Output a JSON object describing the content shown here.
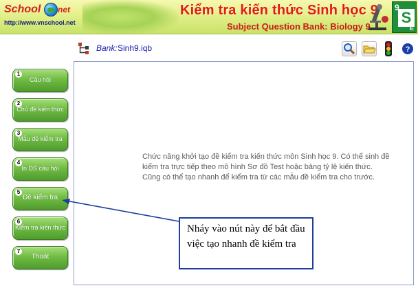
{
  "banner": {
    "logo_school": "School",
    "logo_net": "net",
    "logo_url": "http://www.vnschool.net",
    "title": "Kiểm tra kiến thức Sinh học 9",
    "subtitle": "Subject Question Bank: Biology 9",
    "grade_number": "9",
    "grade_letter": "S",
    "grade_corner": "E"
  },
  "toolbar": {
    "bank_label": "Bank:",
    "bank_file": "Sinh9.iqb",
    "icons": [
      "tree-icon",
      "search-icon",
      "folder-open-icon",
      "traffic-light-icon",
      "help-icon"
    ],
    "help_glyph": "?"
  },
  "sidebar": {
    "items": [
      {
        "num": "1",
        "label": "Câu hỏi"
      },
      {
        "num": "2",
        "label": "Chủ đề kiến thức"
      },
      {
        "num": "3",
        "label": "Mẫu đề kiểm tra"
      },
      {
        "num": "4",
        "label": "In DS câu hỏi"
      },
      {
        "num": "5",
        "label": "Đề kiểm tra"
      },
      {
        "num": "6",
        "label": "Kiểm tra kiến thức"
      },
      {
        "num": "7",
        "label": "Thoát"
      }
    ]
  },
  "main": {
    "intro_text": "Chức năng khởi tạo đề kiểm tra kiến thức môn Sinh học 9. Có thể sinh đề kiểm tra trực tiếp theo mô hình Sơ đồ Test hoặc bảng tỷ lệ kiến thức. Cũng có thể tạo nhanh để kiểm tra từ các mẫu đề kiểm tra cho trước."
  },
  "callout": {
    "text": "Nháy vào nút này để bắt đầu việc tạo nhanh đề kiểm tra"
  },
  "colors": {
    "banner_bg": "#e3f08a",
    "title_red": "#e01b1b",
    "button_green": "#6fbd43",
    "callout_border": "#1f3d9e"
  }
}
